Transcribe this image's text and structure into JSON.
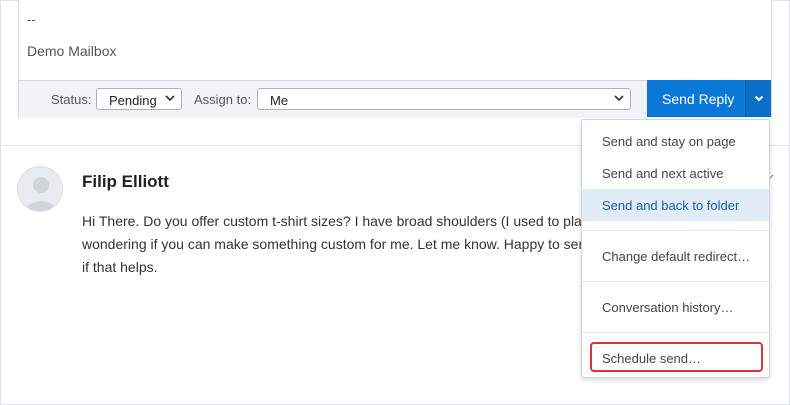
{
  "signature": {
    "dash": "--",
    "mailbox": "Demo Mailbox"
  },
  "toolbar": {
    "status_label": "Status:",
    "status_value": "Pending",
    "assign_label": "Assign to:",
    "assign_value": "Me",
    "send_label": "Send Reply"
  },
  "thread": {
    "author": "Filip Elliott",
    "lines": [
      "Hi There. Do you offer custom t-shirt sizes? I have broad shoulders (I used to pla",
      "wondering if you can make something custom for me. Let me know. Happy to sen",
      "if that helps."
    ]
  },
  "send_menu": {
    "items": [
      "Send and stay on page",
      "Send and next active",
      "Send and back to folder",
      "Change default redirect…",
      "Conversation history…",
      "Schedule send…"
    ],
    "active_index": 2,
    "highlighted_index": 5
  },
  "colors": {
    "primary": "#0a78d7",
    "active_item_bg": "#e1ecf7",
    "highlight_border": "#d9333f"
  }
}
